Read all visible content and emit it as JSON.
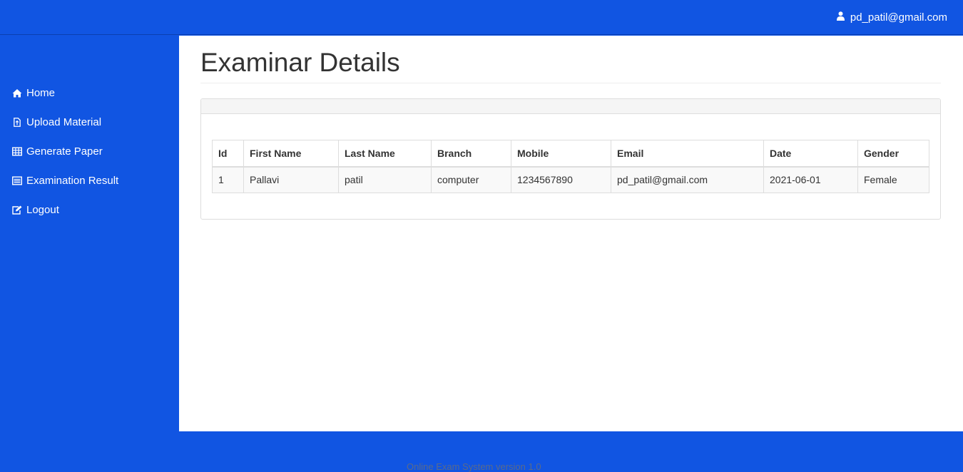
{
  "header": {
    "user_email": "pd_patil@gmail.com"
  },
  "sidebar": {
    "items": [
      {
        "label": "Home",
        "icon": "home-icon"
      },
      {
        "label": "Upload Material",
        "icon": "file-upload-icon"
      },
      {
        "label": "Generate Paper",
        "icon": "table-icon"
      },
      {
        "label": "Examination Result",
        "icon": "list-icon"
      },
      {
        "label": "Logout",
        "icon": "edit-icon"
      }
    ]
  },
  "main": {
    "title": "Examinar Details",
    "table": {
      "headers": [
        "Id",
        "First Name",
        "Last Name",
        "Branch",
        "Mobile",
        "Email",
        "Date",
        "Gender"
      ],
      "rows": [
        [
          "1",
          "Pallavi",
          "patil",
          "computer",
          "1234567890",
          "pd_patil@gmail.com",
          "2021-06-01",
          "Female"
        ]
      ]
    }
  },
  "footer": {
    "text": "Online Exam System version 1.0"
  },
  "colors": {
    "brand": "#1155e2",
    "text": "#333333",
    "border": "#dddddd"
  }
}
